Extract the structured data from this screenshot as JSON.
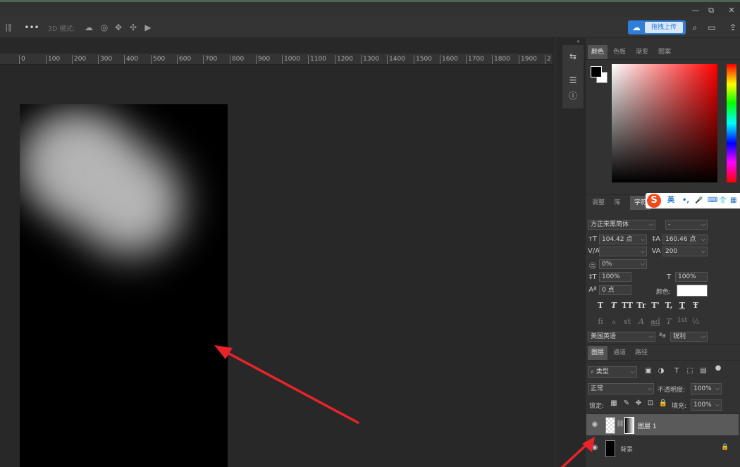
{
  "titlebar": {
    "minimize": "—",
    "restore": "⧉",
    "close": "✕"
  },
  "options": {
    "more": "•••",
    "mode3d": "3D 模式:",
    "upload_label": "拖拽上传"
  },
  "ruler": [
    "0",
    "100",
    "200",
    "300",
    "400",
    "500",
    "600",
    "700",
    "800",
    "900",
    "1000",
    "1100",
    "1200",
    "1300",
    "1400",
    "1500",
    "1600",
    "1700",
    "1800",
    "1900",
    "2"
  ],
  "color_tabs": [
    "颜色",
    "色板",
    "渐变",
    "图案"
  ],
  "char_tabs": [
    "调整",
    "库",
    "字符"
  ],
  "ime": {
    "s": "S",
    "lang": "英",
    "punct": "•,",
    "mic": "🎤",
    "kbd": "⌨",
    "skin": "👕",
    "grid": "▦"
  },
  "character": {
    "font_family": "方正宋黑简体",
    "font_style": "-",
    "font_size": "104.42 点",
    "leading": "160.46 点",
    "kerning": "",
    "tracking": "200",
    "scale_pct": "0%",
    "vscale": "100%",
    "hscale": "100%",
    "baseline": "0 点",
    "color_label": "颜色:",
    "type_buttons": [
      "T",
      "T",
      "TT",
      "Tr",
      "T'",
      "T,",
      "T",
      "Ŧ"
    ],
    "ot_buttons": [
      "fi",
      "ℴ",
      "st",
      "A",
      "ad",
      "T",
      "1st",
      "½"
    ],
    "language": "美国英语",
    "aa_label": "ªa",
    "antialias": "锐利"
  },
  "layers_tabs": [
    "图层",
    "通道",
    "路径"
  ],
  "layers": {
    "filter_kind": "类型",
    "blend_mode": "正常",
    "opacity_label": "不透明度:",
    "opacity": "100%",
    "lock_label": "锁定:",
    "fill_label": "填充:",
    "fill": "100%",
    "rows": [
      {
        "name": "图层 1",
        "selected": true
      },
      {
        "name": "背景",
        "selected": false
      }
    ]
  },
  "colors": {
    "accent": "#2f7fd9",
    "arrow": "#e8232b",
    "panel": "#323232",
    "canvas": "#282828"
  }
}
